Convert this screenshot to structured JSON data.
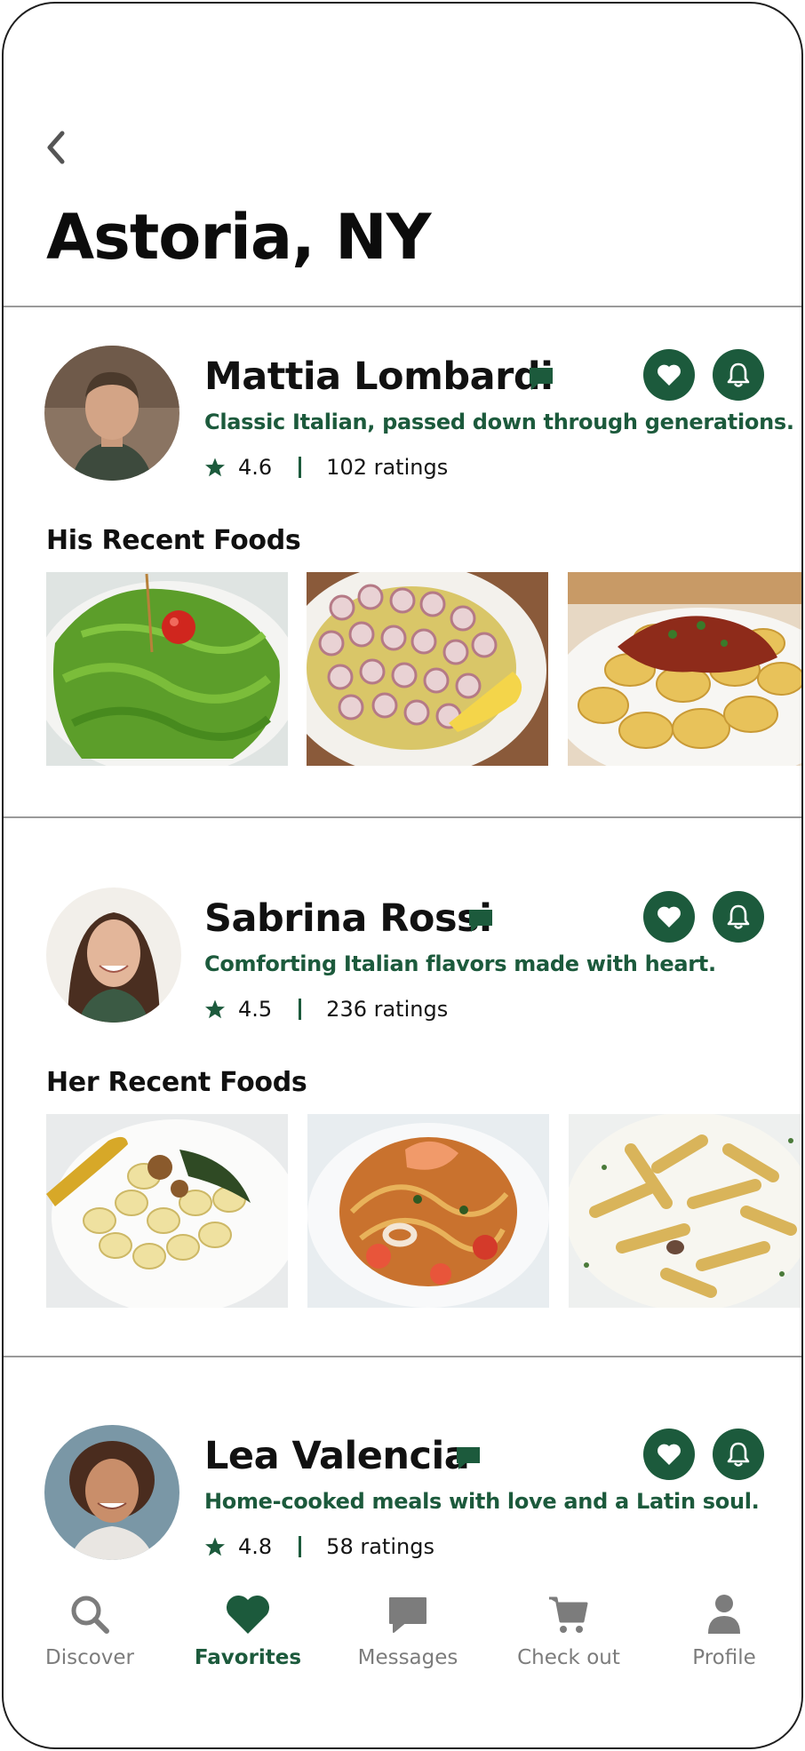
{
  "header": {
    "back_icon": "chevron-left-icon",
    "title": "Astoria, NY"
  },
  "colors": {
    "brand_green": "#1c5a3c",
    "nav_inactive": "#7c7c7c",
    "divider": "#9a9a9a"
  },
  "chefs": [
    {
      "name": "Mattia Lombardi",
      "tagline": "Classic Italian, passed down through generations.",
      "rating": "4.6",
      "ratings_count": "102 ratings",
      "section_label": "His Recent Foods",
      "foods": [
        "pesto-pasta-photo",
        "octopus-carpaccio-photo",
        "tortellini-ragu-photo"
      ]
    },
    {
      "name": "Sabrina Rossi",
      "tagline": "Comforting Italian flavors made with heart.",
      "rating": "4.5",
      "ratings_count": "236 ratings",
      "section_label": "Her Recent Foods",
      "foods": [
        "gnocchi-walnut-photo",
        "seafood-spaghetti-photo",
        "penne-cream-photo"
      ]
    },
    {
      "name": "Lea Valencia",
      "tagline": "Home-cooked meals with love and a Latin soul.",
      "rating": "4.8",
      "ratings_count": "58 ratings"
    }
  ],
  "nav": {
    "items": [
      {
        "label": "Discover",
        "icon": "search-icon"
      },
      {
        "label": "Favorites",
        "icon": "heart-icon",
        "active": true
      },
      {
        "label": "Messages",
        "icon": "chat-icon"
      },
      {
        "label": "Check out",
        "icon": "cart-icon"
      },
      {
        "label": "Profile",
        "icon": "person-icon"
      }
    ]
  }
}
